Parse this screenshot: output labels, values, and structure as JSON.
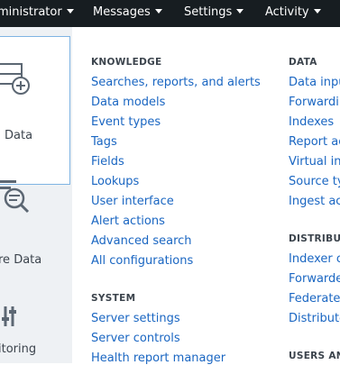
{
  "topnav": {
    "items": [
      "ministrator",
      "Messages",
      "Settings",
      "Activity"
    ]
  },
  "left_panel": {
    "labels": [
      "Data",
      "re Data",
      "itoring"
    ]
  },
  "dropdown": {
    "knowledge": {
      "title": "KNOWLEDGE",
      "items": [
        "Searches, reports, and alerts",
        "Data models",
        "Event types",
        "Tags",
        "Fields",
        "Lookups",
        "User interface",
        "Alert actions",
        "Advanced search",
        "All configurations"
      ]
    },
    "system": {
      "title": "SYSTEM",
      "items": [
        "Server settings",
        "Server controls",
        "Health report manager"
      ]
    },
    "data": {
      "title": "DATA",
      "items": [
        "Data inpu",
        "Forwardir",
        "Indexes",
        "Report ac",
        "Virtual in",
        "Source ty",
        "Ingest ac"
      ]
    },
    "distributed": {
      "title": "DISTRIBUT",
      "items": [
        "Indexer c",
        "Forwarde",
        "Federate",
        "Distribute"
      ]
    },
    "users": {
      "title": "USERS AN"
    }
  }
}
